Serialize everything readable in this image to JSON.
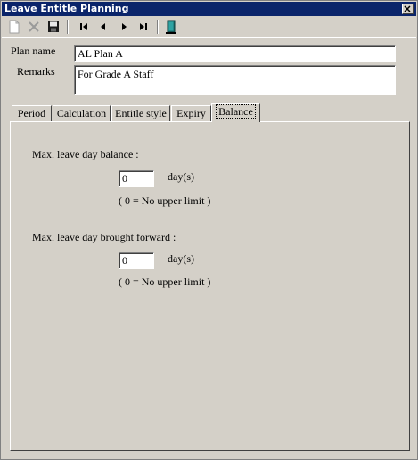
{
  "window": {
    "title": "Leave Entitle Planning"
  },
  "toolbar": {
    "buttons": [
      {
        "icon": "new-document-icon"
      },
      {
        "icon": "delete-x-icon"
      },
      {
        "icon": "save-disk-icon"
      },
      {
        "icon": "first-record-icon"
      },
      {
        "icon": "previous-record-icon"
      },
      {
        "icon": "next-record-icon"
      },
      {
        "icon": "last-record-icon"
      },
      {
        "icon": "exit-door-icon"
      }
    ]
  },
  "form": {
    "plan_name_label": "Plan name",
    "plan_name_value": "AL Plan A",
    "remarks_label": "Remarks",
    "remarks_value": "For Grade A Staff"
  },
  "tabs": [
    {
      "label": "Period",
      "active": false
    },
    {
      "label": "Calculation",
      "active": false
    },
    {
      "label": "Entitle style",
      "active": false
    },
    {
      "label": "Expiry",
      "active": false
    },
    {
      "label": "Balance",
      "active": true
    }
  ],
  "balance": {
    "max_balance_label": "Max. leave day balance :",
    "max_balance_value": "0",
    "max_balance_unit": "day(s)",
    "max_balance_hint": "( 0 = No upper limit )",
    "brought_forward_label": "Max. leave day brought forward :",
    "brought_forward_value": "0",
    "brought_forward_unit": "day(s)",
    "brought_forward_hint": "( 0 = No upper limit )"
  }
}
